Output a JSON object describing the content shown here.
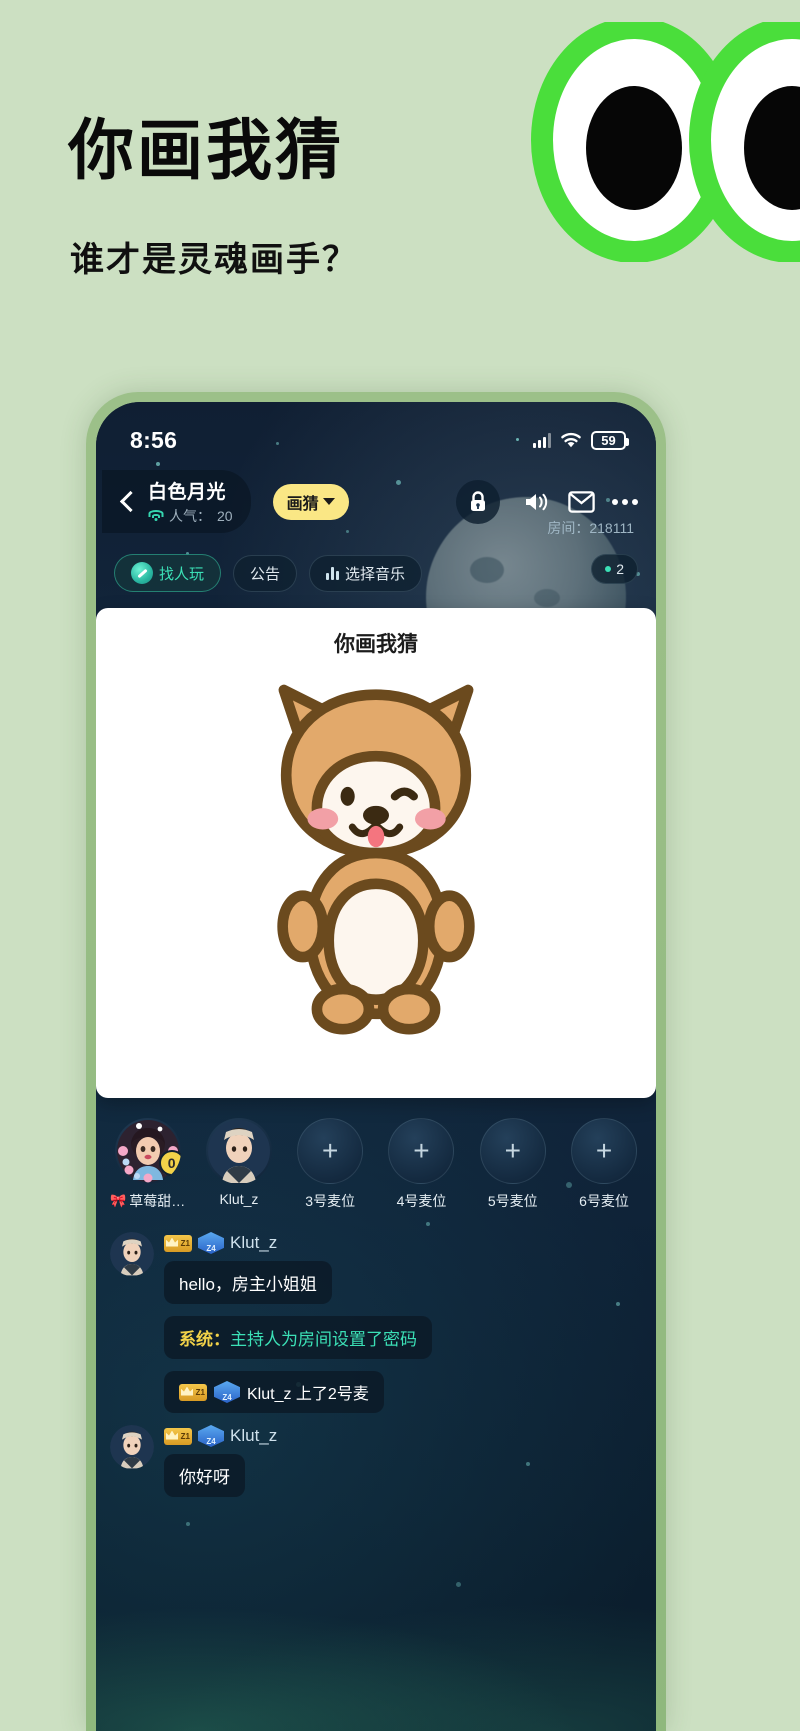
{
  "promo": {
    "title": "你画我猜",
    "subtitle": "谁才是灵魂画手？",
    "bg_color": "#cce0c2",
    "eye_color": "#4ade3b"
  },
  "phone": {
    "statusbar": {
      "time": "8:56",
      "signal_icon": "cellular-signal-icon",
      "wifi_icon": "wifi-icon",
      "battery_level": "59"
    },
    "room_header": {
      "back_icon": "back-arrow-icon",
      "room_name": "白色月光",
      "wifi_icon": "wifi-icon",
      "popularity_label": "人气：",
      "popularity_value": "20",
      "mode_badge": "画猜",
      "lock_icon": "lock-icon",
      "speaker_icon": "speaker-icon",
      "mail_icon": "mail-icon",
      "more_icon": "more-dots-icon",
      "room_number_label": "房间：",
      "room_number": "218111"
    },
    "tabs": [
      {
        "label": "找人玩",
        "icon": "compass-icon",
        "active": true
      },
      {
        "label": "公告",
        "icon": "",
        "active": false
      },
      {
        "label": "选择音乐",
        "icon": "music-bars-icon",
        "active": false
      }
    ],
    "online_count": "2",
    "game_card": {
      "title": "你画我猜",
      "drawing": "shiba-inu-dog-drawing"
    },
    "seats": [
      {
        "label": "草莓甜…",
        "type": "occupied",
        "decor": "bow-icon",
        "score": "0",
        "avatar": "female-avatar"
      },
      {
        "label": "Klut_z",
        "type": "occupied",
        "decor": "",
        "score": "",
        "avatar": "male-avatar"
      },
      {
        "label": "3号麦位",
        "type": "empty",
        "decor": "",
        "score": "",
        "avatar": "plus-icon"
      },
      {
        "label": "4号麦位",
        "type": "empty",
        "decor": "",
        "score": "",
        "avatar": "plus-icon"
      },
      {
        "label": "5号麦位",
        "type": "empty",
        "decor": "",
        "score": "",
        "avatar": "plus-icon"
      },
      {
        "label": "6号麦位",
        "type": "empty",
        "decor": "",
        "score": "",
        "avatar": "plus-icon"
      }
    ],
    "chat": [
      {
        "kind": "user",
        "name": "Klut_z",
        "crown_badge": "Z1",
        "gem_badge": "Z4",
        "text": "hello，房主小姐姐"
      },
      {
        "kind": "system",
        "prefix": "系统：",
        "text": "主持人为房间设置了密码"
      },
      {
        "kind": "enter",
        "crown_badge": "Z1",
        "gem_badge": "Z4",
        "text": "Klut_z 上了2号麦"
      },
      {
        "kind": "user",
        "name": "Klut_z",
        "crown_badge": "Z1",
        "gem_badge": "Z4",
        "text": "你好呀"
      }
    ]
  }
}
